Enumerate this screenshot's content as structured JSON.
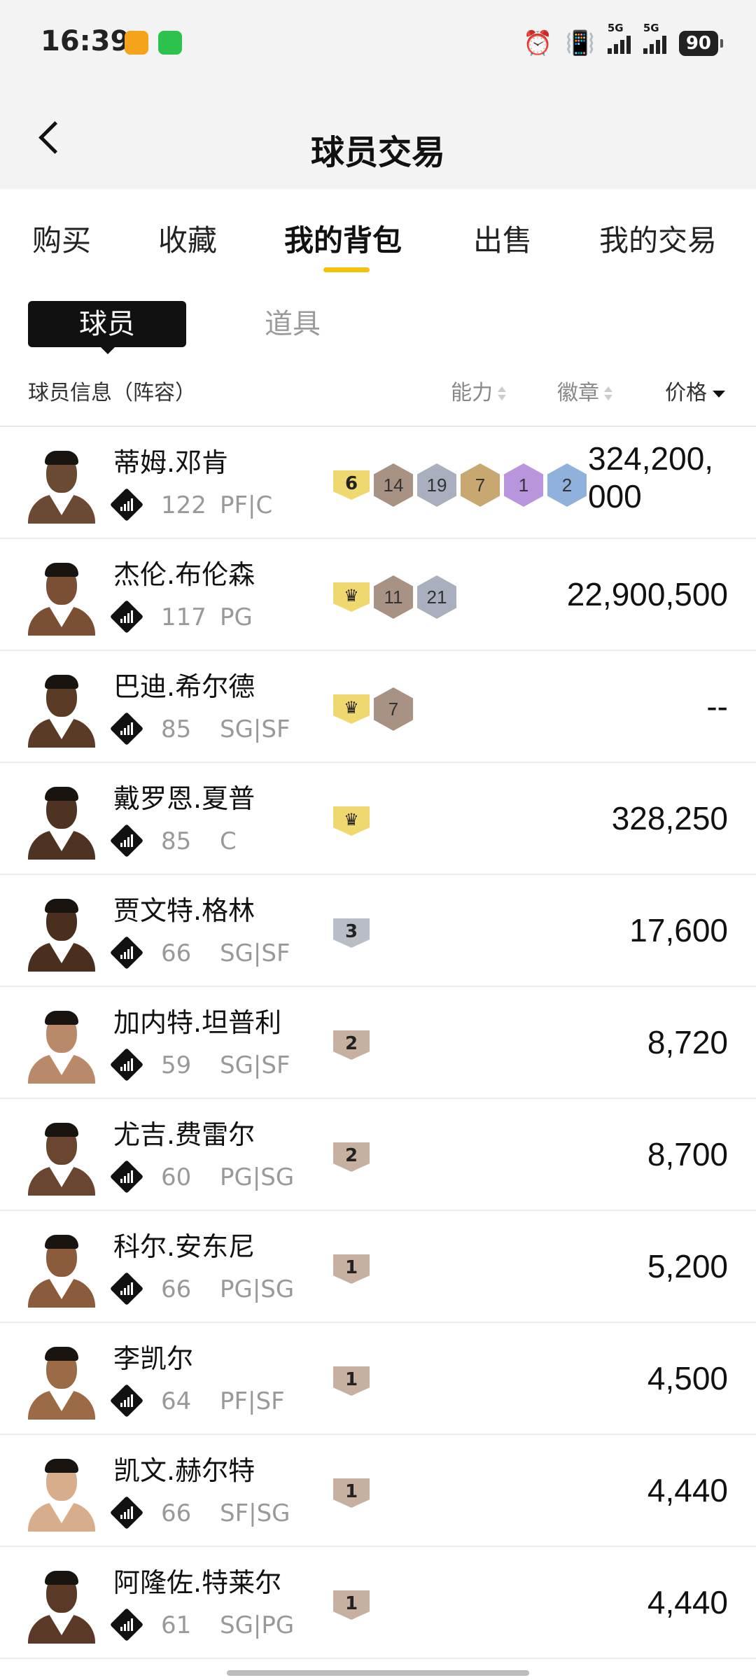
{
  "status_bar": {
    "time": "16:39",
    "network_1": "5G",
    "network_2": "5G",
    "battery": "90",
    "icons": [
      "alarm-icon",
      "vibrate-icon",
      "signal-icon",
      "signal-icon",
      "battery-icon"
    ]
  },
  "header": {
    "title": "球员交易",
    "back_icon": "chevron-left-icon"
  },
  "tabs": [
    {
      "label": "购买"
    },
    {
      "label": "收藏"
    },
    {
      "label": "我的背包",
      "active": true
    },
    {
      "label": "出售"
    },
    {
      "label": "我的交易"
    }
  ],
  "segments": {
    "active": "球员",
    "inactive": "道具"
  },
  "columns": {
    "info": "球员信息（阵容）",
    "ability": "能力",
    "badge": "徽章",
    "price": "价格"
  },
  "colors": {
    "accent": "#f6c10b",
    "text": "#111111",
    "muted": "#999999"
  },
  "players": [
    {
      "name": "蒂姆.邓肯",
      "rating": "122",
      "position": "PF|C",
      "tier": "6",
      "tier_style": "yellow",
      "badges": [
        {
          "n": "14",
          "c": "bronze"
        },
        {
          "n": "19",
          "c": "silver"
        },
        {
          "n": "7",
          "c": "gold"
        },
        {
          "n": "1",
          "c": "purple"
        },
        {
          "n": "2",
          "c": "blue"
        }
      ],
      "price": "324,200,000",
      "skin": "#6b4a33",
      "rating_icon": "04"
    },
    {
      "name": "杰伦.布伦森",
      "rating": "117",
      "position": "PG",
      "tier": "crown",
      "tier_style": "yellow",
      "badges": [
        {
          "n": "11",
          "c": "bronze"
        },
        {
          "n": "21",
          "c": "silver"
        }
      ],
      "price": "22,900,500",
      "skin": "#7a4f33"
    },
    {
      "name": "巴迪.希尔德",
      "rating": "85",
      "position": "SG|SF",
      "tier": "crown",
      "tier_style": "yellow",
      "badges": [
        {
          "n": "7",
          "c": "bronze"
        }
      ],
      "price": "--",
      "skin": "#5a3b26"
    },
    {
      "name": "戴罗恩.夏普",
      "rating": "85",
      "position": "C",
      "tier": "crown",
      "tier_style": "yellow",
      "badges": [],
      "price": "328,250",
      "skin": "#4e3322"
    },
    {
      "name": "贾文特.格林",
      "rating": "66",
      "position": "SG|SF",
      "tier": "3",
      "tier_style": "silver",
      "badges": [],
      "price": "17,600",
      "skin": "#4a2f1f"
    },
    {
      "name": "加内特.坦普利",
      "rating": "59",
      "position": "SG|SF",
      "tier": "2",
      "tier_style": "bronze",
      "badges": [],
      "price": "8,720",
      "skin": "#b98a6a"
    },
    {
      "name": "尤吉.费雷尔",
      "rating": "60",
      "position": "PG|SG",
      "tier": "2",
      "tier_style": "bronze",
      "badges": [],
      "price": "8,700",
      "skin": "#6a4630"
    },
    {
      "name": "科尔.安东尼",
      "rating": "66",
      "position": "PG|SG",
      "tier": "1",
      "tier_style": "bronze",
      "badges": [],
      "price": "5,200",
      "skin": "#8a5c3c"
    },
    {
      "name": "李凯尔",
      "rating": "64",
      "position": "PF|SF",
      "tier": "1",
      "tier_style": "bronze",
      "badges": [],
      "price": "4,500",
      "skin": "#9b6b48"
    },
    {
      "name": "凯文.赫尔特",
      "rating": "66",
      "position": "SF|SG",
      "tier": "1",
      "tier_style": "bronze",
      "badges": [],
      "price": "4,440",
      "skin": "#d8ad8c"
    },
    {
      "name": "阿隆佐.特莱尔",
      "rating": "61",
      "position": "SG|PG",
      "tier": "1",
      "tier_style": "bronze",
      "badges": [],
      "price": "4,440",
      "skin": "#5a3a27"
    }
  ]
}
